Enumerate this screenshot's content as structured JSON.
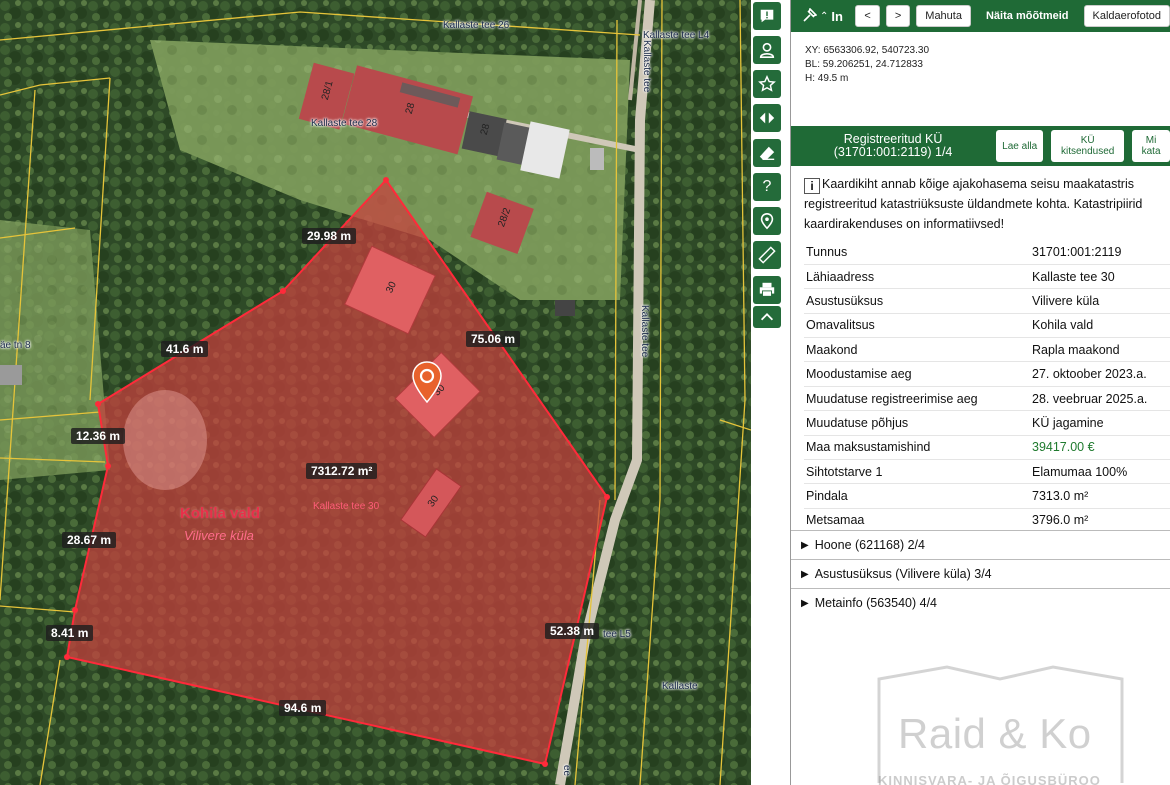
{
  "map": {
    "road_labels": {
      "kallaste_tee_26": "Kallaste tee 26",
      "kallaste_tee_l4": "Kallaste tee L4",
      "kallaste_tee_28": "Kallaste tee 28",
      "kallaste_tee_vertical_top": "Kallaste tee",
      "kallaste_tee_vertical_mid": "Kallaste tee",
      "tn8": "äe tn 8",
      "kallaste_tee_l5": "tee L5",
      "kallaste": "Kallaste",
      "tee_bottom": "ee"
    },
    "building_labels": {
      "b28_1": "28/1",
      "b28": "28",
      "b28b": "28",
      "b28_2": "28/2",
      "b30a": "30",
      "b30b": "30",
      "b30c": "30"
    },
    "dimensions": {
      "d1": "29.98 m",
      "d2": "41.6 m",
      "d3": "75.06 m",
      "d4": "12.36 m",
      "d5": "7312.72 m²",
      "d6": "28.67 m",
      "d7": "8.41 m",
      "d8": "52.38 m",
      "d9": "94.6 m"
    },
    "municipality": "Kohila vald",
    "village": "Vilivere küla",
    "parcel_address": "Kallaste tee 30"
  },
  "toolbar": {
    "icons": [
      "feedback-icon",
      "user-icon",
      "star-icon",
      "compare-icon",
      "eraser-icon",
      "help-icon",
      "location-pin-icon",
      "ruler-icon",
      "print-icon",
      "chevron-up-icon"
    ],
    "help_glyph": "?"
  },
  "panel": {
    "topbar": {
      "title_glyph": "In",
      "prev": "<",
      "next": ">",
      "fit": "Mahuta",
      "show_measures": "Näita mõõtmeid",
      "coastal_photos": "Kaldaerofotod"
    },
    "coords": {
      "xy": "XY: 6563306.92, 540723.30",
      "bl": "BL: 59.206251, 24.712833",
      "h": "H: 49.5 m"
    },
    "registry": {
      "title_line1": "Registreeritud KÜ",
      "title_line2": "(31701:001:2119) 1/4",
      "download": "Lae alla",
      "restrictions": "KÜ kitsendused",
      "more": "Mi kata"
    },
    "info_text": "Kaardikiht annab kõige ajakohasema seisu maakatastris registreeritud katastriüksuste üldandmete kohta. Katastripiirid kaardirakenduses on informatiivsed!",
    "info_glyph": "i",
    "attributes": [
      {
        "key": "Tunnus",
        "value": "31701:001:2119"
      },
      {
        "key": "Lähiaadress",
        "value": "Kallaste tee 30"
      },
      {
        "key": "Asustusüksus",
        "value": "Vilivere küla"
      },
      {
        "key": "Omavalitsus",
        "value": "Kohila vald"
      },
      {
        "key": "Maakond",
        "value": "Rapla maakond"
      },
      {
        "key": "Moodustamise aeg",
        "value": "27. oktoober 2023.a."
      },
      {
        "key": "Muudatuse registreerimise aeg",
        "value": "28. veebruar 2025.a."
      },
      {
        "key": "Muudatuse põhjus",
        "value": "KÜ jagamine"
      },
      {
        "key": "Maa maksustamishind",
        "value": "39417.00 €"
      },
      {
        "key": "Sihtotstarve 1",
        "value": "Elamumaa 100%"
      },
      {
        "key": "Pindala",
        "value": "7313.0 m²"
      },
      {
        "key": "Metsamaa",
        "value": "3796.0 m²"
      }
    ],
    "accordions": [
      {
        "label": "Hoone (621168) 2/4"
      },
      {
        "label": "Asustusüksus (Vilivere küla) 3/4"
      },
      {
        "label": "Metainfo (563540) 4/4"
      }
    ]
  },
  "watermark": {
    "brand": "Raid & Ko",
    "subtitle": "KINNISVARA- JA ÕIGUSBÜROO"
  },
  "colors": {
    "brand_green": "#1f6a36",
    "parcel_fill": "#c9403f",
    "parcel_edge": "#ff2a3a"
  }
}
